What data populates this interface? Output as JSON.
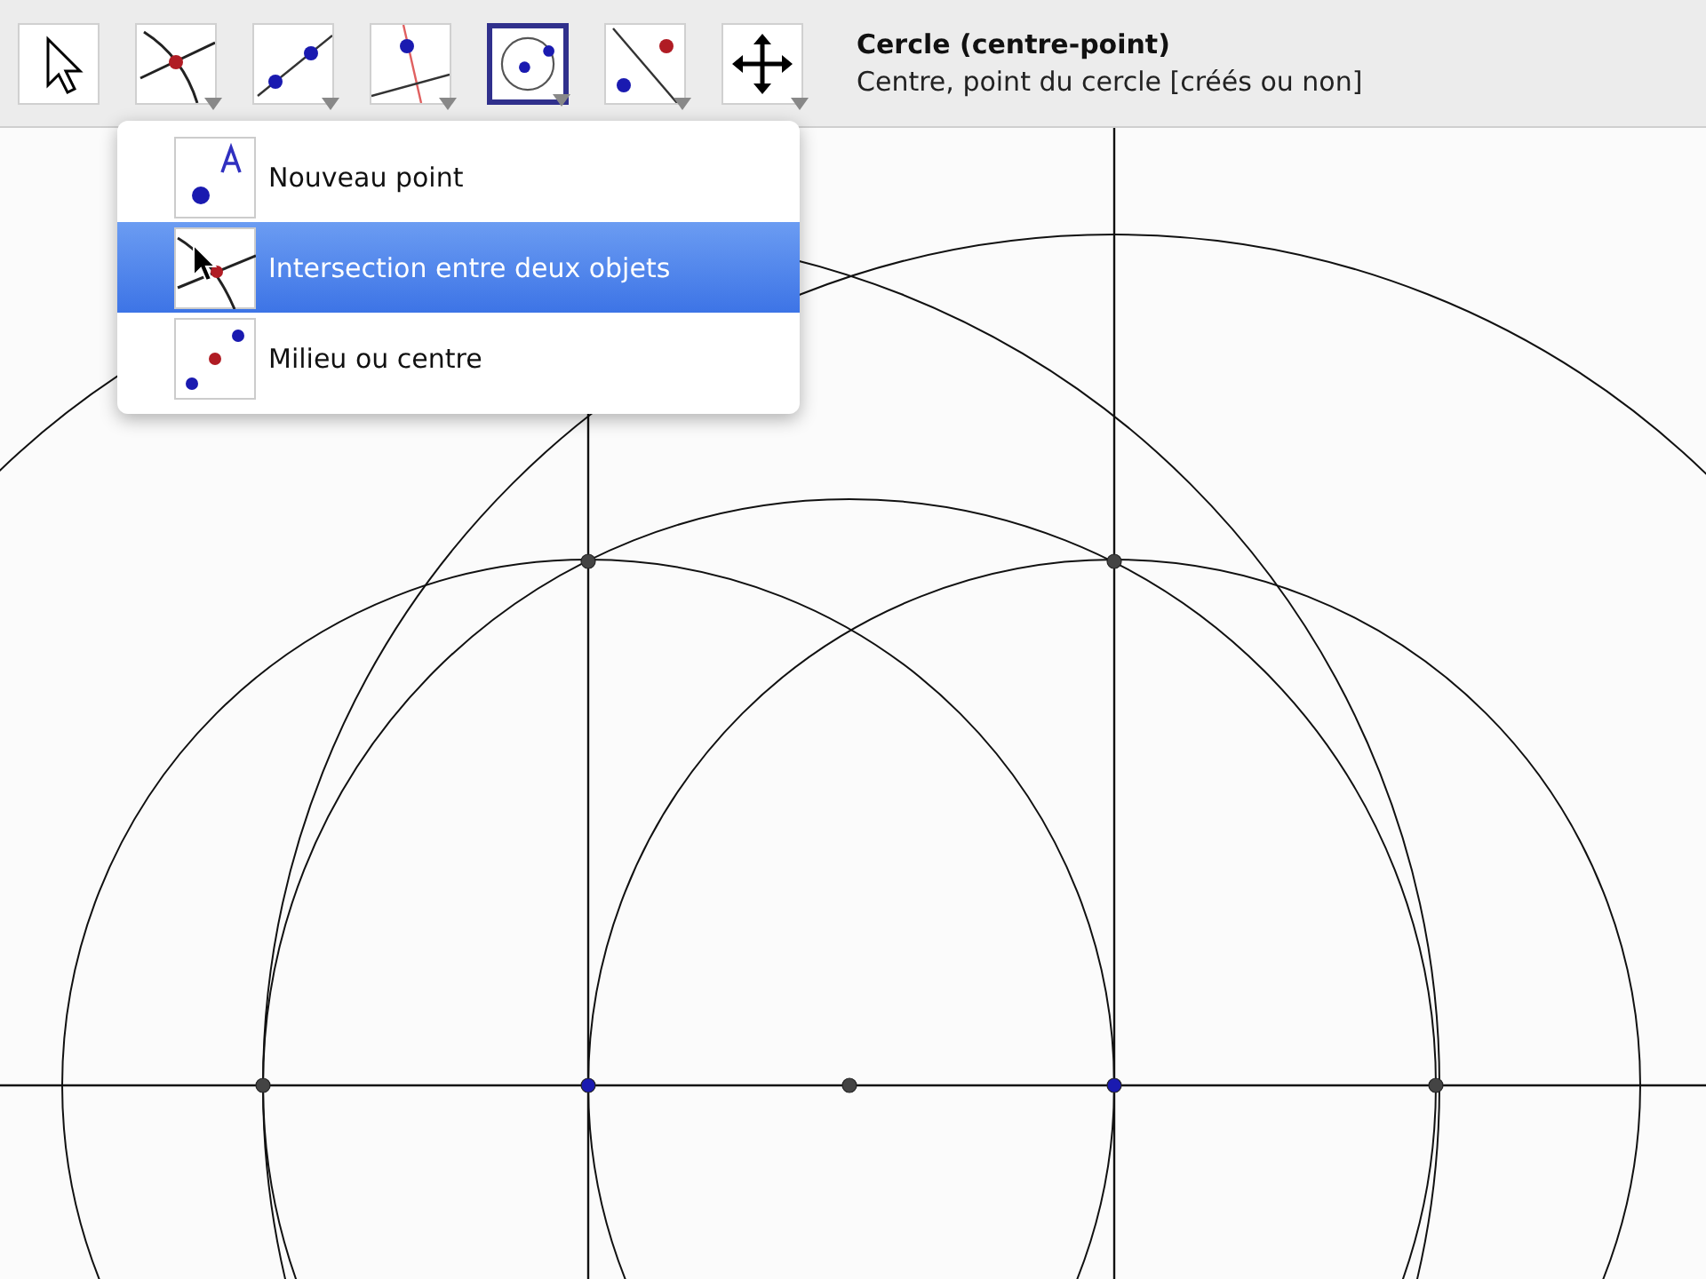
{
  "toolbar": {
    "tools": [
      {
        "selected": false,
        "submenu": false
      },
      {
        "selected": false,
        "submenu": true
      },
      {
        "selected": false,
        "submenu": true
      },
      {
        "selected": false,
        "submenu": true
      },
      {
        "selected": true,
        "submenu": true
      },
      {
        "selected": false,
        "submenu": true
      },
      {
        "selected": false,
        "submenu": true
      }
    ],
    "tool_info": {
      "title": "Cercle (centre-point)",
      "description": "Centre, point du cercle [créés ou non]"
    }
  },
  "tool_menu": {
    "items": [
      {
        "label": "Nouveau point",
        "selected": false
      },
      {
        "label": "Intersection entre deux objets",
        "selected": true
      },
      {
        "label": "Milieu ou centre",
        "selected": false
      }
    ]
  }
}
